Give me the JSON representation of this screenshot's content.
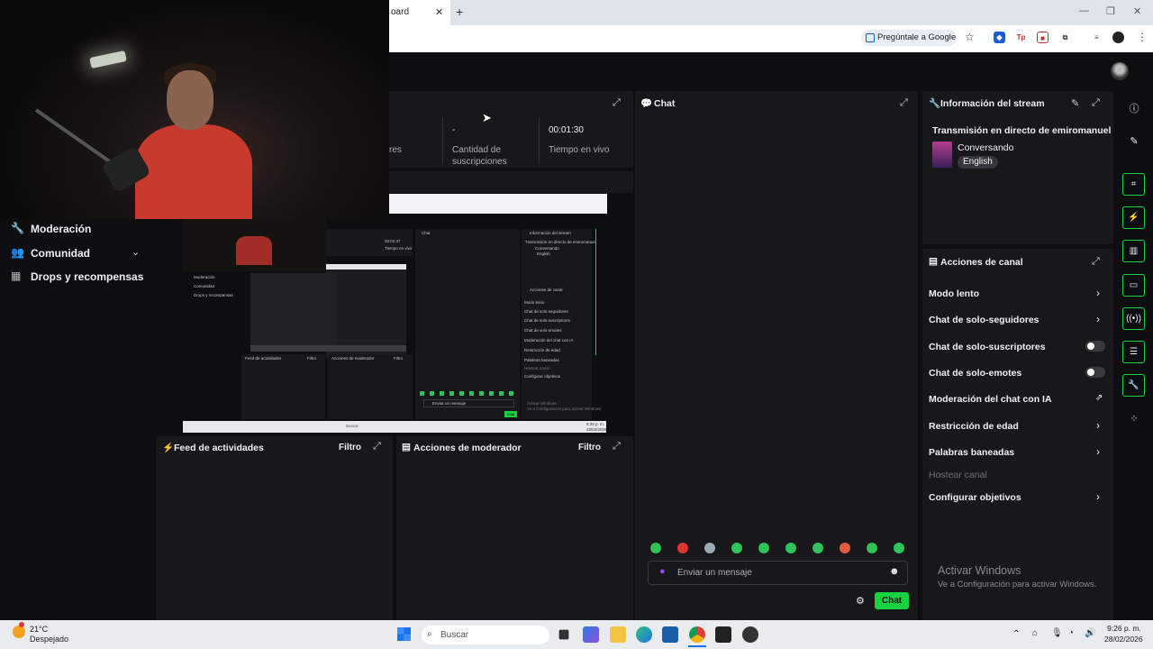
{
  "browser": {
    "tab_title": "oard",
    "tab_close": "✕",
    "new_tab": "+",
    "ask_google": "Pregúntale a Google",
    "window_controls": [
      "—",
      "❐",
      "✕"
    ]
  },
  "sidebar": {
    "items": [
      {
        "label": "Moderación",
        "icon": "wrench-icon"
      },
      {
        "label": "Comunidad",
        "icon": "community-icon"
      },
      {
        "label": "Drops y recompensas",
        "icon": "gift-icon"
      }
    ]
  },
  "stats": {
    "cut_label": "res",
    "subs_value": "-",
    "subs_label_1": "Cantidad de",
    "subs_label_2": "suscripciones",
    "live_value": "00:01:30",
    "live_label": "Tiempo en vivo"
  },
  "panels": {
    "feed_title": "Feed de actividades",
    "feed_filter": "Filtro",
    "mod_title": "Acciones de moderador",
    "mod_filter": "Filtro"
  },
  "chat": {
    "title": "Chat",
    "placeholder": "Enviar un mensaje",
    "send_label": "Chat",
    "emote_count": 10
  },
  "stream_info": {
    "title": "Información del stream",
    "stream_title": "Transmisión en directo de emiromanuel",
    "category": "Conversando",
    "language": "English"
  },
  "channel_actions": {
    "title": "Acciones de canal",
    "items": [
      {
        "label": "Modo lento",
        "control": "chevron"
      },
      {
        "label": "Chat de solo-seguidores",
        "control": "chevron"
      },
      {
        "label": "Chat de solo-suscriptores",
        "control": "toggle",
        "on": false
      },
      {
        "label": "Chat de solo-emotes",
        "control": "toggle",
        "on": false
      },
      {
        "label": "Moderación del chat con IA",
        "control": "external"
      },
      {
        "label": "Restricción de edad",
        "control": "chevron"
      },
      {
        "label": "Palabras baneadas",
        "control": "chevron"
      },
      {
        "label": "Hostear canal",
        "control": "disabled"
      },
      {
        "label": "Configurar objetivos",
        "control": "chevron"
      }
    ]
  },
  "watermark": {
    "line1": "Activar Windows",
    "line2": "Ve a Configuración para activar Windows."
  },
  "taskbar": {
    "weather_temp": "21°C",
    "weather_desc": "Despejado",
    "search_placeholder": "Buscar",
    "time": "9:26 p. m.",
    "date": "28/02/2026"
  },
  "preview": {
    "sidebar_items": [
      "Moderación",
      "Comunidad",
      "Drops y recompensas"
    ],
    "live_value": "00:01:37",
    "live_label": "Tiempo en vivo",
    "feed_title": "Feed de actividades",
    "mod_title": "Acciones de moderador",
    "filter": "Filtro",
    "chat_title": "Chat",
    "info_title": "Información del stream",
    "info_stream": "Transmisión en directo de emiromanuel",
    "info_cat": "Conversando",
    "info_lang": "English",
    "actions_title": "Acciones de canal",
    "actions": [
      "Modo lento",
      "Chat de solo-seguidores",
      "Chat de solo-suscriptores",
      "Chat de solo-emotes",
      "Moderación del chat con IA",
      "Restricción de edad",
      "Palabras baneadas",
      "Hostear canal",
      "Configurar objetivos"
    ],
    "chat_placeholder": "Enviar un mensaje",
    "chat_send": "Chat",
    "wm1": "Activar Windows",
    "wm2": "Ve a Configuración para activar Windows",
    "search": "Buscar",
    "time": "9:26 p. m.",
    "date": "28/02/2026"
  },
  "colors": {
    "accent": "#19d241",
    "panel": "#18181b",
    "background": "#0e0e10"
  }
}
